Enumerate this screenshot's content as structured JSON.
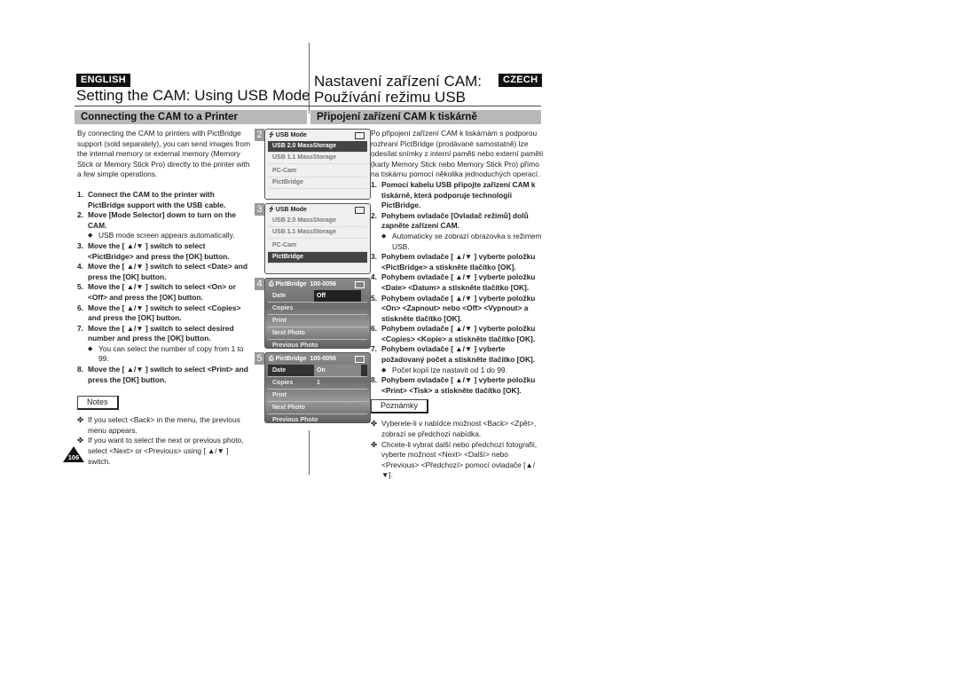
{
  "header": {
    "left_language": "ENGLISH",
    "right_language": "CZECH",
    "left_title": "Setting the CAM: Using USB Mode",
    "right_title_line1": "Nastavení zařízení CAM:",
    "right_title_line2": "Používání režimu USB",
    "left_section": "Connecting the CAM to a Printer",
    "right_section": "Připojení zařízení CAM k tiskárně"
  },
  "english": {
    "intro": "By connecting the CAM to printers with PictBridge support (sold separately), you can send images from the internal memory or external memory (Memory Stick or Memory Stick Pro) directly to the printer with a few simple operations.",
    "steps": [
      {
        "num": "1.",
        "text": "Connect the CAM to the printer with PictBridge support with the USB cable."
      },
      {
        "num": "2.",
        "text": "Move [Mode Selector] down to turn on the CAM.",
        "bullet": "USB mode screen appears automatically."
      },
      {
        "num": "3.",
        "text": "Move the [ ▲/▼ ] switch to select <PictBridge> and press the [OK] button."
      },
      {
        "num": "4.",
        "text": "Move the [ ▲/▼ ] switch to select <Date> and press the [OK] button."
      },
      {
        "num": "5.",
        "text": "Move the [ ▲/▼ ] switch to select <On> or <Off> and press the [OK] button."
      },
      {
        "num": "6.",
        "text": "Move the [ ▲/▼ ] switch to select <Copies> and press the [OK] button."
      },
      {
        "num": "7.",
        "text": "Move the [ ▲/▼ ] switch to select desired number and press the [OK] button.",
        "bullet": "You can select the number of copy from 1 to 99."
      },
      {
        "num": "8.",
        "text": "Move the [ ▲/▼ ] switch to select <Print> and press the [OK] button."
      }
    ],
    "notes_label": "Notes",
    "notes": [
      "If you select <Back> in the menu, the previous menu appears.",
      "If you want to select the next or previous photo, select <Next> or <Previous> using [ ▲/▼ ] switch."
    ]
  },
  "czech": {
    "intro": "Po připojení zařízení CAM k tiskárnám s podporou rozhraní PictBridge (prodávané samostatně) lze odesílat snímky z interní paměti nebo externí paměti (karty Memory Stick nebo Memory Stick Pro) přímo na tiskárnu pomocí několika jednoduchých operací.",
    "steps": [
      {
        "num": "1.",
        "text": "Pomocí kabelu USB připojte zařízení CAM k tiskárně, která podporuje technologii PictBridge."
      },
      {
        "num": "2.",
        "text": "Pohybem ovladače [Ovladač režimů] dolů zapněte zařízení CAM.",
        "bullet": "Automaticky se zobrazí obrazovka s režimem USB."
      },
      {
        "num": "3.",
        "text": "Pohybem ovladače [ ▲/▼ ] vyberte položku <PictBridge> a stiskněte tlačítko [OK]."
      },
      {
        "num": "4.",
        "text": "Pohybem ovladače [ ▲/▼ ] vyberte položku <Date> <Datum> a stiskněte tlačítko [OK]."
      },
      {
        "num": "5.",
        "text": "Pohybem ovladače [ ▲/▼ ] vyberte položku <On> <Zapnout> nebo <Off> <Vypnout> a stiskněte tlačítko [OK]."
      },
      {
        "num": "6.",
        "text": "Pohybem ovladače [ ▲/▼ ] vyberte položku <Copies> <Kopie> a stiskněte tlačítko [OK]."
      },
      {
        "num": "7.",
        "text": "Pohybem ovladače [ ▲/▼ ] vyberte požadovaný počet a stiskněte tlačítko [OK].",
        "bullet": "Počet kopií lze nastavit od 1 do 99."
      },
      {
        "num": "8.",
        "text": "Pohybem ovladače [ ▲/▼ ] vyberte položku <Print> <Tisk> a stiskněte tlačítko [OK]."
      }
    ],
    "notes_label": "Poznámky",
    "notes": [
      "Vyberete-li v nabídce možnost <Back> <Zpět>, zobrazí se předchozí nabídka.",
      "Chcete-li vybrat další nebo předchozí fotografii, vyberte možnost <Next> <Další> nebo <Previous> <Předchozí> pomocí ovladače [▲/▼]."
    ]
  },
  "screens": [
    {
      "num": "2",
      "header": "USB Mode",
      "items": [
        "USB 2.0 MassStorage",
        "USB 1.1 MassStorage",
        "PC-Cam",
        "PictBridge"
      ],
      "selected": 0
    },
    {
      "num": "3",
      "header": "USB Mode",
      "items": [
        "USB 2.0 MassStorage",
        "USB 1.1 MassStorage",
        "PC-Cam",
        "PictBridge"
      ],
      "selected": 3
    },
    {
      "num": "4",
      "header": "PictBridge",
      "file": "100-0056",
      "rows": [
        "Date",
        "Copies",
        "Print",
        "Next Photo",
        "Previous Photo"
      ],
      "date_value": "Off"
    },
    {
      "num": "5",
      "header": "PictBridge",
      "file": "100-0056",
      "rows": [
        "Date",
        "Copies",
        "Print",
        "Next Photo",
        "Previous Photo"
      ],
      "date_value": "On",
      "copies_value": "1"
    }
  ],
  "page_number": "106",
  "icons": {
    "usb": "⭍",
    "diamond": "◆",
    "note": "✤",
    "printer": "⎙"
  }
}
